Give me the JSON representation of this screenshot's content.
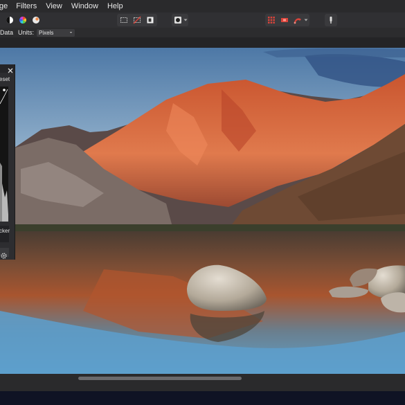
{
  "menu": {
    "items": [
      {
        "label": "ge"
      },
      {
        "label": "Filters"
      },
      {
        "label": "View"
      },
      {
        "label": "Window"
      },
      {
        "label": "Help"
      }
    ]
  },
  "context_bar": {
    "data_label": "Data",
    "units_label": "Units:",
    "units_value": "Pixels"
  },
  "curves_panel": {
    "reset_label": "eset",
    "picker_label": "cker"
  },
  "icons": {
    "toolbar": [
      "contrast-icon",
      "color-wheel-icon",
      "color-picker-icon",
      "marquee-select-icon",
      "deselect-icon",
      "invert-selection-icon",
      "mask-icon",
      "grid-icon",
      "snapping-icon",
      "assistant-icon",
      "export-persona-icon"
    ]
  },
  "colors": {
    "menubar": "#2a2a2c",
    "toolbar": "#303033",
    "taskbar": "#0f1324",
    "accent_red": "#d9443b"
  }
}
